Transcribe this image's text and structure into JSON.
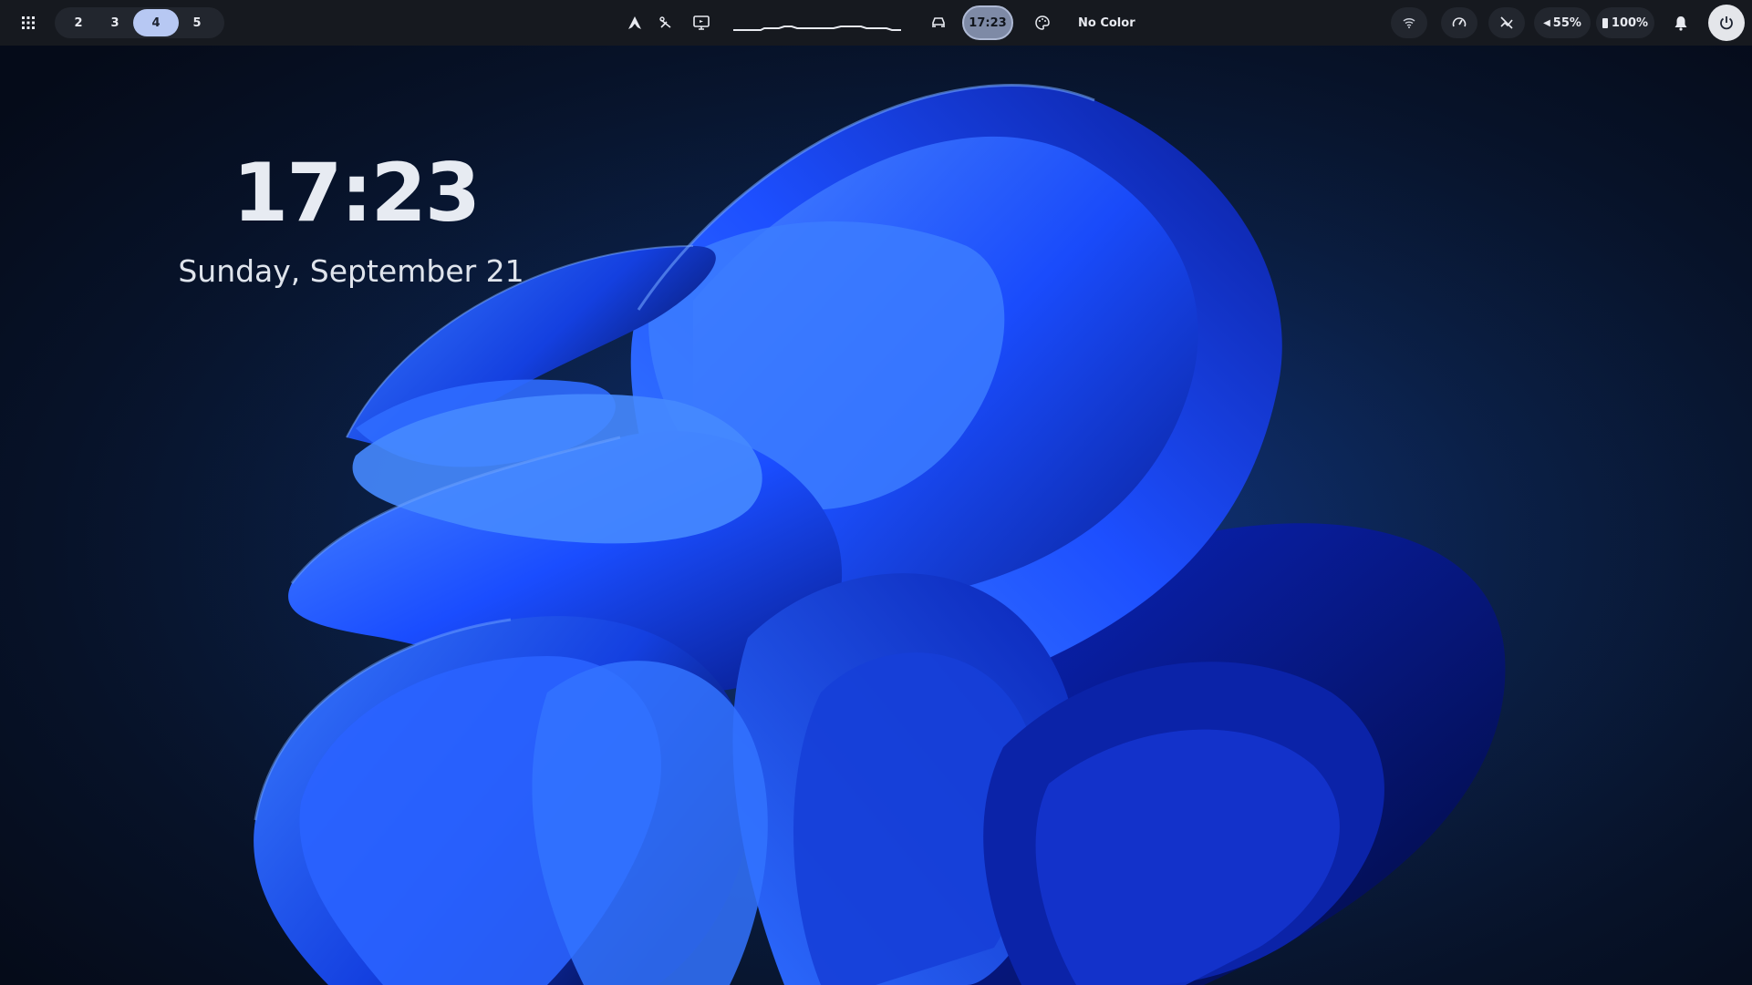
{
  "topbar": {
    "apps_icon": "grid-icon",
    "workspaces": [
      {
        "label": "2",
        "active": false
      },
      {
        "label": "3",
        "active": false
      },
      {
        "label": "4",
        "active": true
      },
      {
        "label": "5",
        "active": false
      }
    ],
    "clock": "17:23",
    "color_picker_label": "No Color",
    "volume": "55%",
    "battery": "100%"
  },
  "lockscreen": {
    "time": "17:23",
    "date": "Sunday, September 21"
  },
  "colors": {
    "bar_bg": "#16191f",
    "pill_bg": "#22262e",
    "active_workspace": "#b7c8f3",
    "clock_pill": "#7e8aa6",
    "wallpaper_blue": "#1f5cff"
  }
}
